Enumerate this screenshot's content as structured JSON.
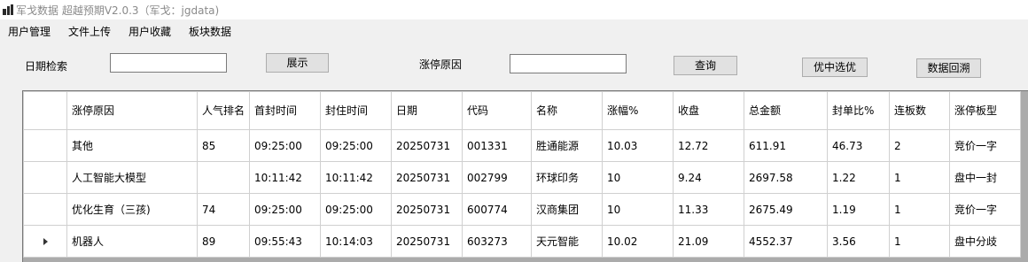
{
  "window": {
    "title": "军戈数据 超越预期V2.0.3（军戈：jgdata)"
  },
  "menu": [
    "用户管理",
    "文件上传",
    "用户收藏",
    "板块数据"
  ],
  "filters": {
    "date_label": "日期检索",
    "date_value": "",
    "show_button": "展示",
    "reason_label": "涨停原因",
    "reason_value": "",
    "query_button": "查询",
    "pick_button": "优中选优",
    "backtrack_button": "数据回溯"
  },
  "table": {
    "columns": [
      "涨停原因",
      "人气排名",
      "首封时间",
      "封住时间",
      "日期",
      "代码",
      "名称",
      "涨幅%",
      "收盘",
      "总金额",
      "封单比%",
      "连板数",
      "涨停板型"
    ],
    "rows": [
      [
        "其他",
        "85",
        "09:25:00",
        "09:25:00",
        "20250731",
        "001331",
        "胜通能源",
        "10.03",
        "12.72",
        "611.91",
        "46.73",
        "2",
        "竞价一字"
      ],
      [
        "人工智能大模型",
        "",
        "10:11:42",
        "10:11:42",
        "20250731",
        "002799",
        "环球印务",
        "10",
        "9.24",
        "2697.58",
        "1.22",
        "1",
        "盘中一封"
      ],
      [
        "优化生育（三孩)",
        "74",
        "09:25:00",
        "09:25:00",
        "20250731",
        "600774",
        "汉商集团",
        "10",
        "11.33",
        "2675.49",
        "1.19",
        "1",
        "竞价一字"
      ],
      [
        "机器人",
        "89",
        "09:55:43",
        "10:14:03",
        "20250731",
        "603273",
        "天元智能",
        "10.02",
        "21.09",
        "4552.37",
        "3.56",
        "1",
        "盘中分歧"
      ]
    ],
    "current_row": 3
  }
}
